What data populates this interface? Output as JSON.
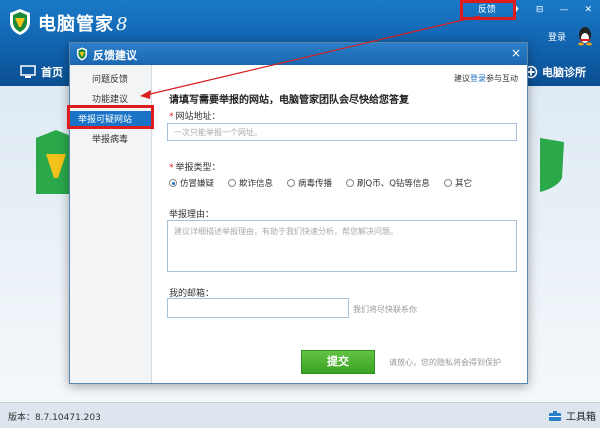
{
  "app": {
    "title": "电脑管家",
    "title_mark": "8",
    "login": "登录",
    "feedback": "反馈",
    "version": "版本：8.7.10471.203",
    "toolbox": "工具箱"
  },
  "nav": {
    "home": "首页",
    "diagnosis": "电脑诊所"
  },
  "dialog": {
    "title": "反馈建议",
    "close": "×",
    "sidebar": {
      "items": [
        {
          "label": "问题反馈",
          "active": false
        },
        {
          "label": "功能建议",
          "active": false
        },
        {
          "label": "举报可疑网站",
          "active": true
        },
        {
          "label": "举报病毒",
          "active": false
        }
      ]
    },
    "top_link": {
      "prefix": "建议",
      "link": "登录",
      "suffix": "参与互动"
    },
    "heading": "请填写需要举报的网站，电脑管家团队会尽快给您答复",
    "url_label": "网站地址：",
    "url_placeholder": "一次只能举报一个网址。",
    "type_label": "举报类型：",
    "types": [
      {
        "label": "仿冒嫌疑",
        "selected": true
      },
      {
        "label": "欺诈信息",
        "selected": false
      },
      {
        "label": "病毒传播",
        "selected": false
      },
      {
        "label": "刷Q币、Q钻等信息",
        "selected": false
      },
      {
        "label": "其它",
        "selected": false
      }
    ],
    "reason_label": "举报理由：",
    "reason_placeholder": "建议详细描述举报理由，有助于我们快速分析，帮您解决问题。",
    "email_label": "我的邮箱：",
    "email_hint": "我们将尽快联系你",
    "submit": "提交",
    "privacy": "请放心，您的隐私将会得到保护"
  },
  "colors": {
    "accent": "#1a73c6",
    "highlight": "#e01b1b",
    "submit": "#4cb232"
  }
}
